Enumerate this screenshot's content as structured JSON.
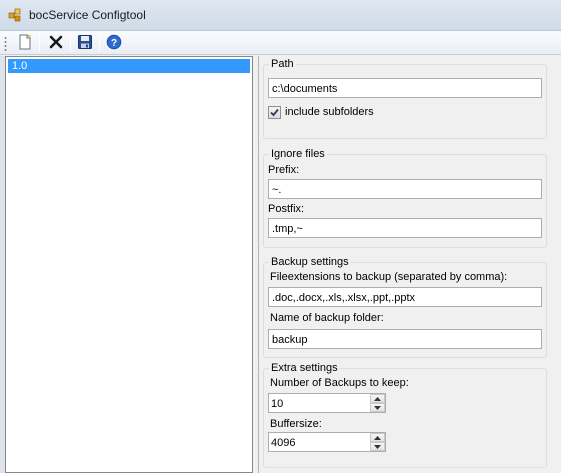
{
  "window": {
    "title": "bocService Configtool"
  },
  "toolbar": {
    "buttons": [
      {
        "name": "new",
        "icon": "new-document-icon"
      },
      {
        "name": "delete",
        "icon": "delete-x-icon"
      },
      {
        "name": "save",
        "icon": "save-disk-icon"
      },
      {
        "name": "help",
        "icon": "help-icon"
      }
    ]
  },
  "list": {
    "items": [
      {
        "label": "1.0",
        "selected": true
      }
    ]
  },
  "path_group": {
    "legend": "Path",
    "path_value": "c:\\documents",
    "include_subfolders_label": "include subfolders",
    "include_subfolders_checked": true
  },
  "ignore_group": {
    "legend": "Ignore files",
    "prefix_label": "Prefix:",
    "prefix_value": "~.",
    "postfix_label": "Postfix:",
    "postfix_value": ".tmp,~"
  },
  "backup_group": {
    "legend": "Backup settings",
    "extensions_label": "Fileextensions to backup (separated by comma):",
    "extensions_value": ".doc,.docx,.xls,.xlsx,.ppt,.pptx",
    "folder_label": "Name of backup folder:",
    "folder_value": "backup"
  },
  "extra_group": {
    "legend": "Extra settings",
    "num_backups_label": "Number of Backups to keep:",
    "num_backups_value": "10",
    "buffersize_label": "Buffersize:",
    "buffersize_value": "4096"
  },
  "colors": {
    "selection": "#3399ff",
    "delete_icon": "#1a1a1a",
    "save_icon": "#2a4f9a",
    "help_icon": "#2d6bd0"
  }
}
